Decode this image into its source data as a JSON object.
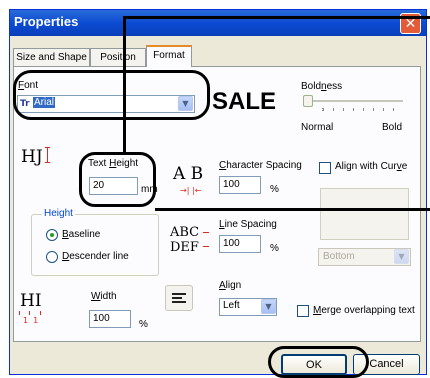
{
  "window": {
    "title": "Properties",
    "close_glyph": "✕"
  },
  "tabs": [
    {
      "label": "Size and Shape",
      "active": false
    },
    {
      "label": "Position",
      "active": false
    },
    {
      "label": "Format",
      "active": true
    }
  ],
  "font": {
    "label": "Font",
    "value": "Arial",
    "icon": "font-type-icon"
  },
  "preview": {
    "text": "SALE"
  },
  "boldness": {
    "label": "Boldness",
    "min_label": "Normal",
    "max_label": "Bold",
    "value": 0
  },
  "text_height": {
    "icon_glyph": "HJ",
    "label": "Text Height",
    "value": "20",
    "unit": "mm"
  },
  "character_spacing": {
    "icon_glyph": "A B",
    "label": "Character Spacing",
    "value": "100",
    "unit": "%"
  },
  "align_with_curve": {
    "label": "Align with Curve",
    "checked": false,
    "select_value": "Bottom"
  },
  "height_group": {
    "label": "Height",
    "options": [
      "Baseline",
      "Descender line"
    ],
    "selected": "Baseline"
  },
  "line_spacing": {
    "icon_line1": "ABC",
    "icon_line2": "DEF",
    "label": "Line Spacing",
    "value": "100",
    "unit": "%"
  },
  "width": {
    "icon_glyph": "HI",
    "icon_sub": "1  1",
    "label": "Width",
    "value": "100",
    "unit": "%"
  },
  "align": {
    "label": "Align",
    "value": "Left"
  },
  "merge": {
    "label": "Merge overlapping text",
    "checked": false
  },
  "buttons": {
    "ok": "OK",
    "cancel": "Cancel"
  },
  "colors": {
    "titlebar": "#0b4bd3",
    "accent_red": "#e0281c",
    "dialog_bg": "#ece9d8",
    "annotation": "#000000"
  }
}
